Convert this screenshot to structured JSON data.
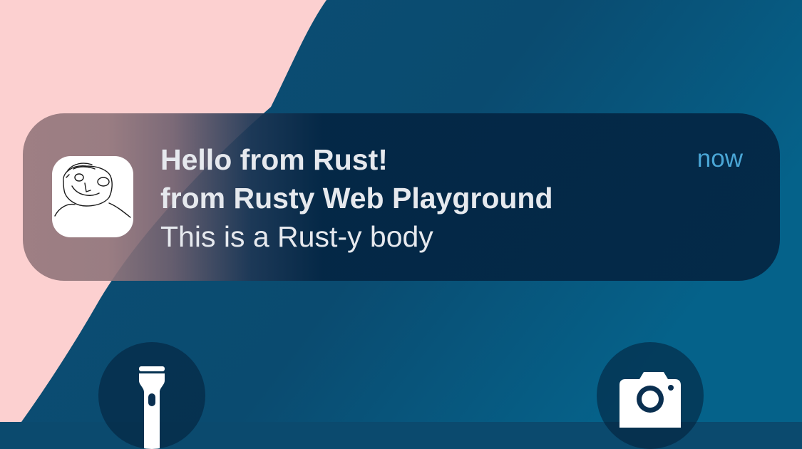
{
  "notification": {
    "title": "Hello from Rust!",
    "subtitle": "from Rusty Web Playground",
    "body": "This is a Rust-y body",
    "time": "now",
    "app_icon": "hand-drawn-face-icon"
  },
  "lockscreen": {
    "left_button_icon": "flashlight-icon",
    "right_button_icon": "camera-icon"
  },
  "colors": {
    "wallpaper_pink": "#fcd0d0",
    "wallpaper_blue": "#075a80",
    "notification_bg": "#04264a",
    "time_text": "#4aa6d6",
    "text": "#e6e9ee"
  }
}
